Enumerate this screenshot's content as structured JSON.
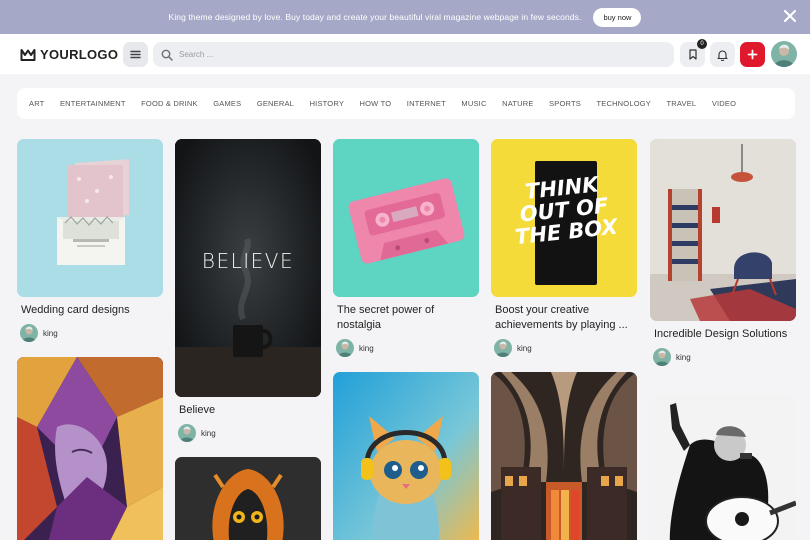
{
  "promo": {
    "text": "King theme designed by love. Buy today and create your beautiful viral magazine webpage in few seconds.",
    "button_label": "buy now"
  },
  "header": {
    "logo_text": "YOURLOGO",
    "search_placeholder": "Search ...",
    "bookmark_count": "0"
  },
  "categories": [
    "ART",
    "ENTERTAINMENT",
    "FOOD & DRINK",
    "GAMES",
    "GENERAL",
    "HISTORY",
    "HOW TO",
    "INTERNET",
    "MUSIC",
    "NATURE",
    "SPORTS",
    "TECHNOLOGY",
    "TRAVEL",
    "VIDEO"
  ],
  "posts": [
    {
      "title": "Wedding card designs",
      "author": "king"
    },
    {
      "title": "Believe",
      "author": "king",
      "image_text": "BELIEVE"
    },
    {
      "title": "The secret power of nostalgia",
      "author": "king"
    },
    {
      "title": "Boost your creative achievements by playing ...",
      "author": "king",
      "image_text": "THINK OUT OF THE BOX"
    },
    {
      "title": "Incredible Design Solutions",
      "author": "king"
    }
  ],
  "colors": {
    "promo_bar": "#a6a8c7",
    "accent_red": "#e0182c",
    "page_bg": "#f4f4f6"
  }
}
